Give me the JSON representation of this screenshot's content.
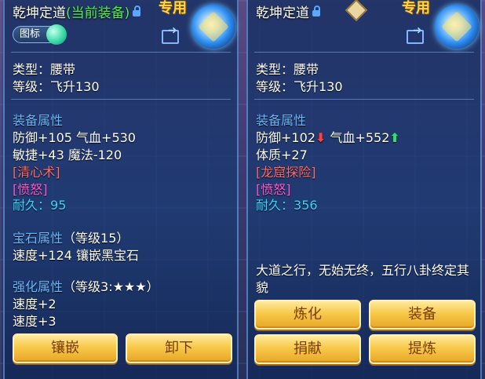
{
  "left_panel": {
    "title": "乾坤定道",
    "title_status": "(当前装备)",
    "exclusive_label": "专用",
    "icon_toggle_label": "图标",
    "type": "类型：腰带",
    "level": "等级：飞升130",
    "equip_attr_header": "装备属性",
    "attr_line1": "防御+105 气血+530",
    "attr_line2": "敏捷+43 魔法-120",
    "special_skill": "[清心术]",
    "special_effect": "[愤怒]",
    "durability_label": "耐久：",
    "durability_value": "95",
    "gem_header": "宝石属性",
    "gem_level": "（等级15）",
    "gem_line": "速度+124 镶嵌黑宝石",
    "enhance_header": "强化属性",
    "enhance_level": "（等级3:★★★）",
    "enhance_line1": "速度+2",
    "enhance_line2": "速度+3",
    "buttons": {
      "inlay": "镶嵌",
      "unequip": "卸下"
    }
  },
  "right_panel": {
    "title": "乾坤定道",
    "exclusive_label": "专用",
    "type": "类型：腰带",
    "level": "等级：飞升130",
    "equip_attr_header": "装备属性",
    "defense": "防御+102",
    "hp": "气血+552",
    "attr_line2": "体质+27",
    "special_skill": "[龙窟探险]",
    "special_effect": "[愤怒]",
    "durability_label": "耐久：",
    "durability_value": "356",
    "description": "大道之行，无始无终，五行八卦终定其貌",
    "buttons": {
      "refine": "炼化",
      "equip": "装备",
      "donate": "捐献",
      "extract": "提炼"
    }
  },
  "colors": {
    "section": "#67b8ff",
    "gold_button": "#f7c94a",
    "exclusive": "#ffd447"
  },
  "icons": [
    "lock-icon",
    "share-icon",
    "gem-avatar",
    "arrow-down-icon",
    "arrow-up-icon",
    "diamond-icon"
  ]
}
